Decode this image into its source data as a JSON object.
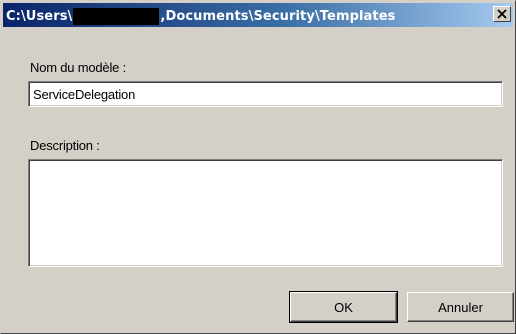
{
  "window": {
    "title_prefix": "C:\\Users\\",
    "title_suffix": ",Documents\\Security\\Templates",
    "close_label": "Close"
  },
  "form": {
    "name_label": "Nom du modèle :",
    "name_value": "ServiceDelegation",
    "description_label": "Description :",
    "description_value": ""
  },
  "buttons": {
    "ok_label": "OK",
    "cancel_label": "Annuler"
  },
  "icons": {
    "close": "close-icon"
  },
  "colors": {
    "title_bar_start": "#0a246a",
    "title_bar_end": "#a6caf0",
    "dialog_face": "#d4d0c8"
  }
}
